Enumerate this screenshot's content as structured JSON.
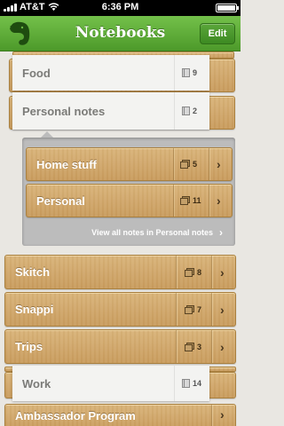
{
  "status_bar": {
    "carrier": "AT&T",
    "time": "6:36 PM"
  },
  "nav_bar": {
    "title": "Notebooks",
    "edit_label": "Edit"
  },
  "top_cards": [
    {
      "label": "Food",
      "count": "9"
    },
    {
      "label": "Personal notes",
      "count": "2"
    }
  ],
  "stack_children": [
    {
      "label": "Home stuff",
      "count": "5"
    },
    {
      "label": "Personal",
      "count": "11"
    }
  ],
  "view_all_label": "View all notes in Personal notes",
  "stacks": [
    {
      "label": "Skitch",
      "count": "8"
    },
    {
      "label": "Snappi",
      "count": "7"
    },
    {
      "label": "Trips",
      "count": "3"
    }
  ],
  "work_card": {
    "label": "Work",
    "count": "14"
  },
  "bottom_stack": {
    "label": "Ambassador Program"
  },
  "icons": {
    "logo": "evernote-elephant-icon",
    "stack": "stack-icon",
    "note": "notebook-icon",
    "chevron": "chevron-right-icon"
  },
  "colors": {
    "nav_green": "#5aab36",
    "wood": "#d0a768",
    "card": "#f3f3f1",
    "panel": "#bcbcbc"
  }
}
